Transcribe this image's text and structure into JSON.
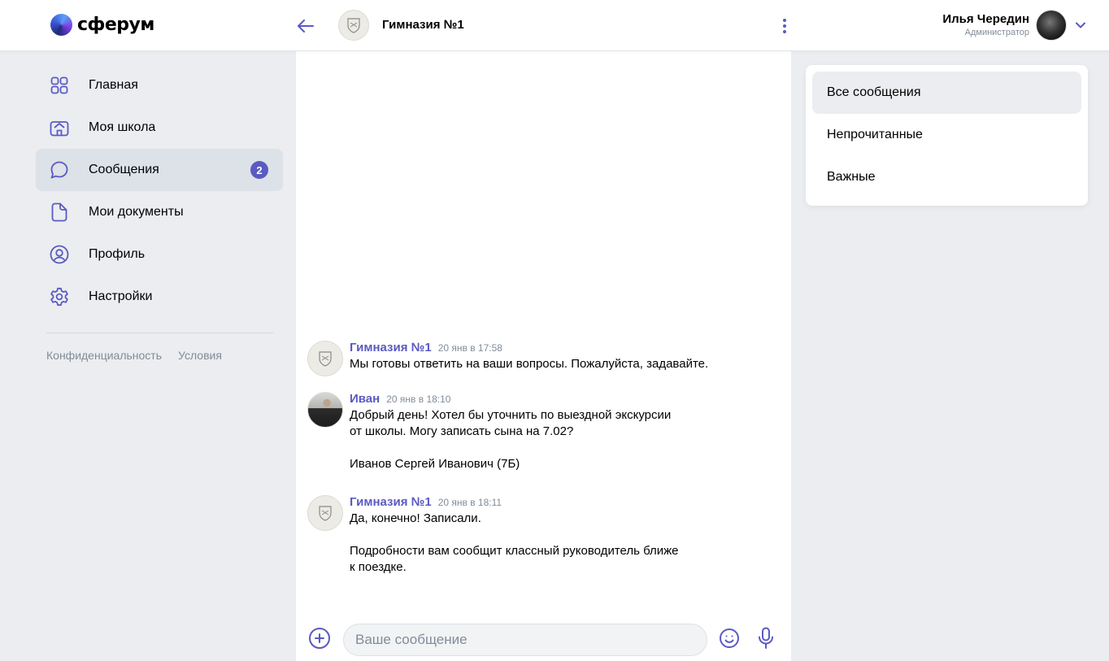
{
  "app": {
    "logo_text": "сферум"
  },
  "header": {
    "chat_title": "Гимназия №1",
    "user_name": "Илья Чередин",
    "user_role": "Администратор"
  },
  "sidebar": {
    "items": [
      {
        "label": "Главная",
        "icon": "grid-icon"
      },
      {
        "label": "Моя школа",
        "icon": "school-icon"
      },
      {
        "label": "Сообщения",
        "icon": "chat-bubble-icon",
        "badge": "2",
        "active": true
      },
      {
        "label": "Мои документы",
        "icon": "document-icon"
      },
      {
        "label": "Профиль",
        "icon": "profile-icon"
      },
      {
        "label": "Настройки",
        "icon": "gear-icon"
      }
    ],
    "footer": {
      "privacy": "Конфиденциальность",
      "terms": "Условия"
    }
  },
  "messages": [
    {
      "author": "Гимназия №1",
      "time": "20 янв в 17:58",
      "paragraphs": [
        "Мы готовы ответить на ваши вопросы. Пожалуйста, задавайте."
      ]
    },
    {
      "author": "Иван",
      "time": "20 янв в 18:10",
      "paragraphs": [
        "Добрый день! Хотел бы уточнить по выездной экскурсии",
        "от школы. Могу записать сына на 7.02?",
        "",
        "Иванов Сергей Иванович (7Б)"
      ]
    },
    {
      "author": "Гимназия №1",
      "time": "20 янв в 18:11",
      "paragraphs": [
        "Да, конечно! Записали.",
        "",
        "Подробности вам сообщит классный руководитель ближе",
        "к поездке."
      ]
    }
  ],
  "composer": {
    "placeholder": "Ваше сообщение",
    "value": ""
  },
  "filters": [
    {
      "label": "Все сообщения",
      "active": true
    },
    {
      "label": "Непрочитанные"
    },
    {
      "label": "Важные"
    }
  ],
  "colors": {
    "accent": "#5a5ac2",
    "page_bg": "#ebedf0",
    "active_item": "#dde1e8",
    "muted_text": "#818c99"
  }
}
